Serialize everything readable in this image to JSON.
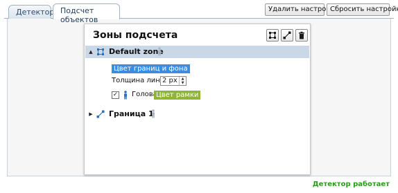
{
  "tabs": [
    {
      "label": "Детектор"
    },
    {
      "label": "Подсчет объектов"
    }
  ],
  "toolbar": {
    "delete_settings": "Удалить настройки",
    "reset_settings": "Сбросить настройки"
  },
  "panel": {
    "title": "Зоны подсчета",
    "tools": [
      "add-zone-icon",
      "add-border-icon",
      "trash-icon"
    ],
    "zone": {
      "name": "Default zone",
      "expanded": true,
      "border_color_label": "Цвет границ и фона",
      "line_thickness_label": "Толщина линии",
      "line_thickness_value": "2 px",
      "head_checked": true,
      "head_label": "Голова",
      "frame_color_label": "Цвет рамки"
    },
    "border": {
      "name": "Граница 1",
      "expanded": false
    }
  },
  "status": "Детектор работает",
  "colors": {
    "zone_row_bg": "#c9d7e7",
    "border_tag": "#3a8de0",
    "frame_tag": "#8fb438",
    "status": "#2a9a1a",
    "icon_blue": "#2f6fb4"
  }
}
